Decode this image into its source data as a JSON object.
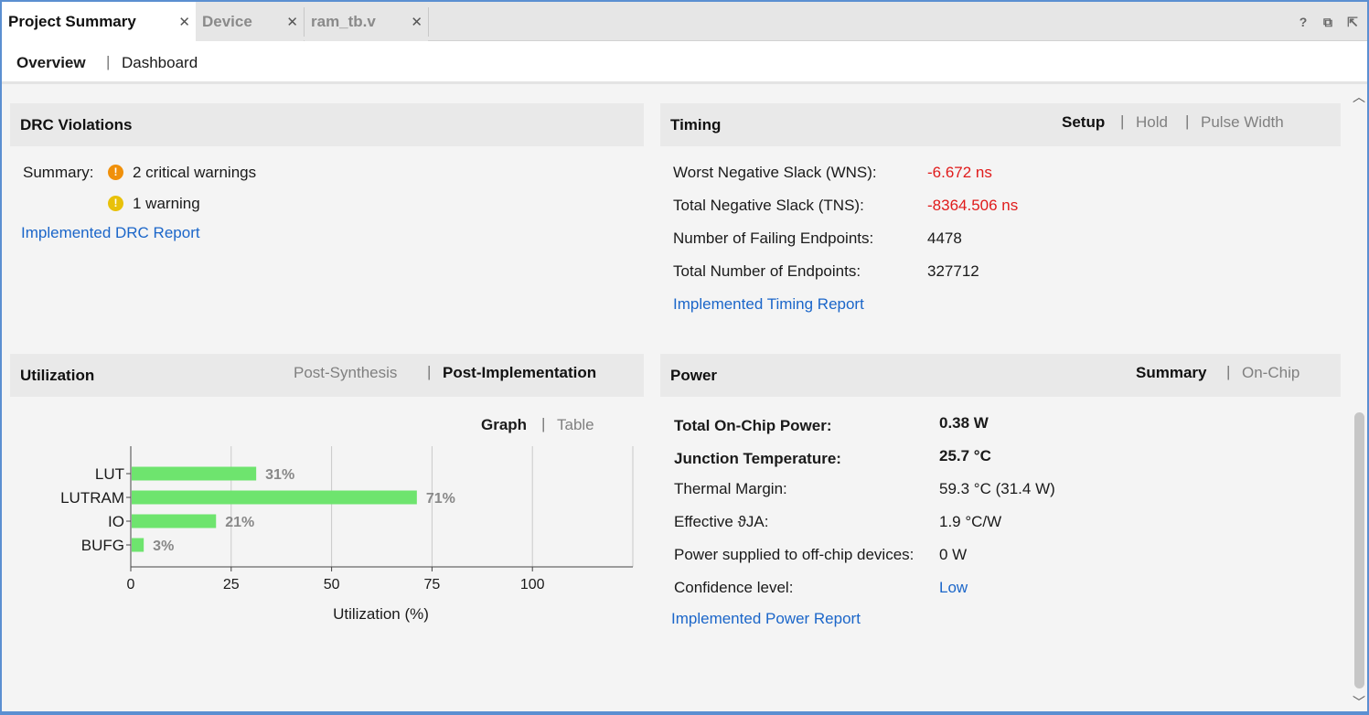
{
  "tabs": [
    {
      "label": "Project Summary",
      "active": true
    },
    {
      "label": "Device",
      "active": false
    },
    {
      "label": "ram_tb.v",
      "active": false
    }
  ],
  "window_icons": [
    "?",
    "⧉",
    "⇱"
  ],
  "subnav": {
    "overview": "Overview",
    "separator": "|",
    "dashboard": "Dashboard"
  },
  "drc": {
    "title": "DRC Violations",
    "summary_label": "Summary:",
    "critical": "2 critical warnings",
    "warning": "1 warning",
    "report_link": "Implemented DRC Report"
  },
  "timing": {
    "title": "Timing",
    "options": [
      "Setup",
      "Hold",
      "Pulse Width"
    ],
    "selected": "Setup",
    "rows": [
      {
        "label": "Worst Negative Slack (WNS):",
        "value": "-6.672 ns"
      },
      {
        "label": "Total Negative Slack (TNS):",
        "value": "-8364.506 ns"
      },
      {
        "label": "Number of Failing Endpoints:",
        "value": "4478"
      },
      {
        "label": "Total Number of Endpoints:",
        "value": "327712"
      }
    ],
    "report_link": "Implemented Timing Report"
  },
  "utilization": {
    "title": "Utilization",
    "options": [
      "Post-Synthesis",
      "Post-Implementation"
    ],
    "selected": "Post-Implementation",
    "view_options": [
      "Graph",
      "Table"
    ],
    "view_selected": "Graph"
  },
  "chart_data": {
    "type": "bar",
    "orientation": "horizontal",
    "categories": [
      "LUT",
      "LUTRAM",
      "IO",
      "BUFG"
    ],
    "values": [
      31,
      71,
      21,
      3
    ],
    "data_labels": [
      "31%",
      "71%",
      "21%",
      "3%"
    ],
    "xlabel": "Utilization (%)",
    "xticks": [
      0,
      25,
      50,
      75,
      100
    ],
    "xlim": [
      0,
      125
    ],
    "grid": "vertical",
    "bar_color": "#6ee46e"
  },
  "power": {
    "title": "Power",
    "options": [
      "Summary",
      "On-Chip"
    ],
    "selected": "Summary",
    "rows": [
      {
        "label": "Total On-Chip Power:",
        "value": "0.38 W"
      },
      {
        "label": "Junction Temperature:",
        "value": "25.7 °C"
      },
      {
        "label": "Thermal Margin:",
        "value": "59.3 °C (31.4 W)"
      },
      {
        "label": "Effective ϑJA:",
        "value": "1.9 °C/W"
      },
      {
        "label": "Power supplied to off-chip devices:",
        "value": "0 W"
      },
      {
        "label": "Confidence level:",
        "value": "Low"
      }
    ],
    "report_link": "Implemented Power Report"
  },
  "colors": {
    "link": "#1b66c9",
    "negative": "#e01b1b",
    "critical_warning": "#f0900a",
    "warning": "#e8c10a",
    "frame": "#5b8fd1"
  }
}
